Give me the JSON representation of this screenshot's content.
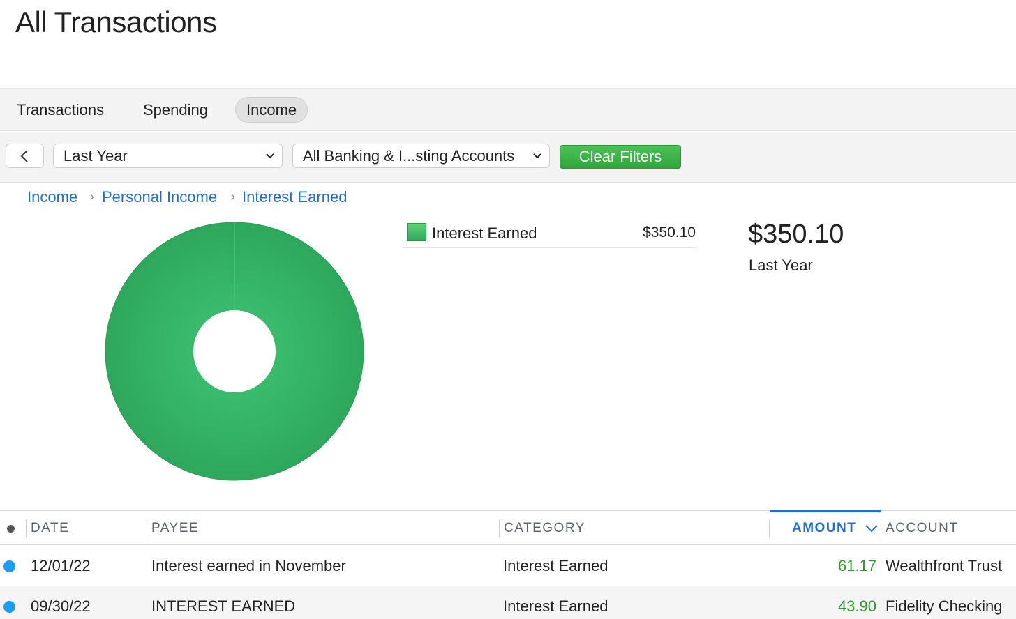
{
  "page": {
    "title": "All Transactions"
  },
  "tabs": [
    {
      "label": "Transactions",
      "active": false
    },
    {
      "label": "Spending",
      "active": false
    },
    {
      "label": "Income",
      "active": true
    }
  ],
  "filters": {
    "period": "Last Year",
    "accounts": "All Banking & I...sting Accounts",
    "clear_label": "Clear Filters"
  },
  "breadcrumb": [
    "Income",
    "Personal Income",
    "Interest Earned"
  ],
  "chart_data": {
    "type": "pie",
    "categories": [
      "Interest Earned"
    ],
    "values": [
      350.1
    ],
    "colors": [
      "#34b064"
    ]
  },
  "legend": [
    {
      "label": "Interest Earned",
      "value": "$350.10"
    }
  ],
  "summary": {
    "amount": "$350.10",
    "period": "Last Year"
  },
  "table": {
    "columns": [
      "DATE",
      "PAYEE",
      "CATEGORY",
      "AMOUNT",
      "ACCOUNT"
    ],
    "sorted_column": "AMOUNT",
    "rows": [
      {
        "date": "12/01/22",
        "payee": "Interest earned in November",
        "category": "Interest Earned",
        "amount": "61.17",
        "account": "Wealthfront Trust"
      },
      {
        "date": "09/30/22",
        "payee": "INTEREST EARNED",
        "category": "Interest Earned",
        "amount": "43.90",
        "account": "Fidelity Checking"
      }
    ]
  },
  "colors": {
    "accent_blue": "#1f6fd1",
    "income_green": "#2e9a2e",
    "button_green": "#3bb347",
    "unread_dot": "#1a9df5"
  }
}
